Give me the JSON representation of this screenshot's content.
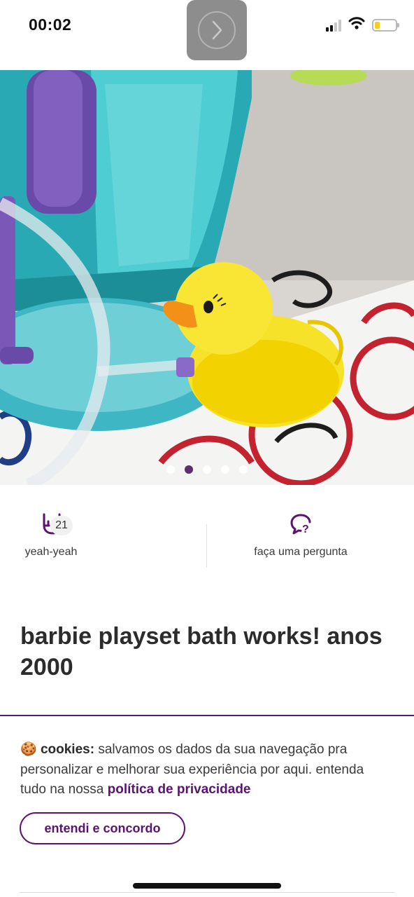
{
  "status_bar": {
    "time": "00:02",
    "icons": [
      "signal-icon",
      "wifi-icon",
      "battery-icon"
    ],
    "battery_level": 0.25
  },
  "gallery": {
    "image_count": 5,
    "active_index": 1,
    "accent_color": "#4e1763"
  },
  "actions": {
    "yeah": {
      "label": "yeah-yeah",
      "count": "21",
      "icon": "rock-hand-icon"
    },
    "ask": {
      "label": "faça uma pergunta",
      "icon": "question-bubble-icon"
    }
  },
  "product": {
    "title": "barbie playset bath works! anos 2000"
  },
  "cookie_banner": {
    "emoji": "🍪",
    "lead": "cookies:",
    "text": " salvamos os dados da sua navegação pra personalizar e melhorar sua experiência por aqui. entenda tudo na nossa ",
    "link": "política de privacidade",
    "button": "entendi e concordo",
    "brand_color": "#5a1470"
  }
}
